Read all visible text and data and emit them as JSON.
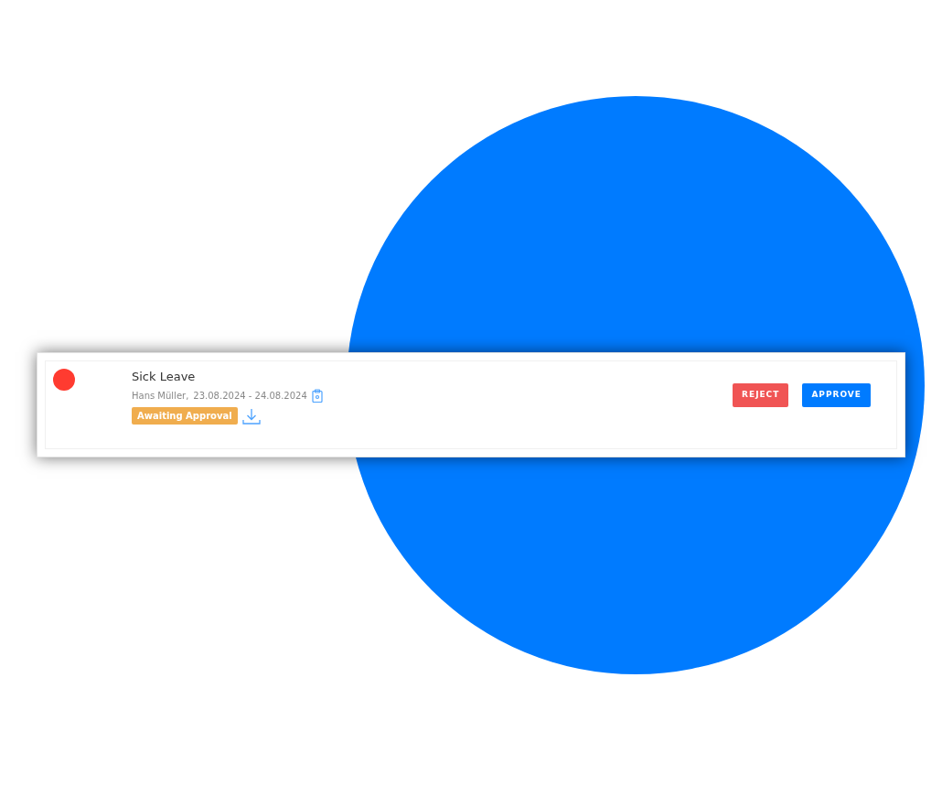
{
  "request": {
    "color": "#ff3b30",
    "title": "Sick Leave",
    "person": "Hans Müller,",
    "dates": "23.08.2024 - 24.08.2024",
    "status": "Awaiting Approval"
  },
  "buttons": [
    {
      "kind": "reject",
      "label": "REJECT"
    },
    {
      "kind": "approve",
      "label": "APPROVE"
    }
  ]
}
